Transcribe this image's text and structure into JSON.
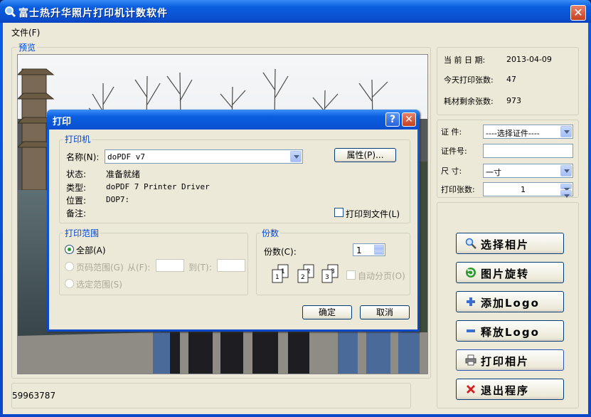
{
  "window": {
    "title": "富士热升华照片打印机计数软件"
  },
  "menu": {
    "file": "文件(F)"
  },
  "preview": {
    "label": "预览"
  },
  "info": {
    "date_label": "当 前 日 期:",
    "date_value": "2013-04-09",
    "today_label": "今天打印张数:",
    "today_value": "47",
    "remain_label": "耗材剩余张数:",
    "remain_value": "973"
  },
  "form": {
    "cert_label": "证  件:",
    "cert_value": "----选择证件----",
    "certno_label": "证件号:",
    "size_label": "尺  寸:",
    "size_value": "一寸",
    "count_label": "打印张数:",
    "count_value": "1"
  },
  "buttons": {
    "select": "选择相片",
    "rotate": "图片旋转",
    "add_logo": "添加Logo",
    "remove_logo": "释放Logo",
    "print": "打印相片",
    "exit": "退出程序"
  },
  "status": {
    "text": "59963787"
  },
  "dialog": {
    "title": "打印",
    "printer_group": "打印机",
    "name_label": "名称(N):",
    "name_value": "doPDF v7",
    "props_button": "属性(P)...",
    "status_label": "状态:",
    "status_value": "准备就绪",
    "type_label": "类型:",
    "type_value": "doPDF 7 Printer Driver",
    "where_label": "位置:",
    "where_value": "DOP7:",
    "comment_label": "备注:",
    "print_to_file": "打印到文件(L)",
    "range_group": "打印范围",
    "all": "全部(A)",
    "pages": "页码范围(G)",
    "from": "从(F):",
    "to": "到(T):",
    "selection": "选定范围(S)",
    "copies_group": "份数",
    "copies_label": "份数(C):",
    "copies_value": "1",
    "collate": "自动分页(O)",
    "ok": "确定",
    "cancel": "取消"
  },
  "colors": {
    "title_bar": "#0a5fe0",
    "client_bg": "#ece9d8",
    "group_label": "#0046d5"
  }
}
